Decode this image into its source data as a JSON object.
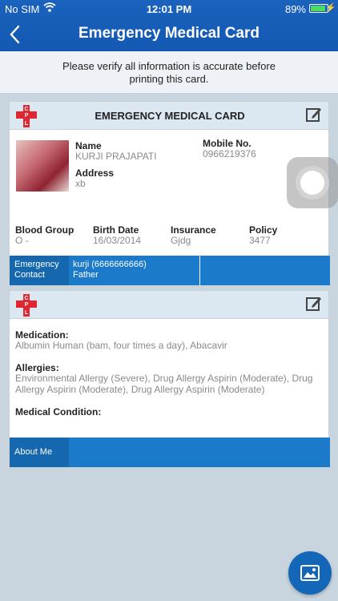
{
  "status_bar": {
    "carrier": "No SIM",
    "time": "12:01 PM",
    "battery_pct": "89%"
  },
  "header": {
    "title": "Emergency Medical Card"
  },
  "notice": {
    "text": "Please verify all information is accurate before printing this card."
  },
  "card": {
    "title": "EMERGENCY MEDICAL CARD",
    "logo_letters": [
      "C",
      "P",
      "L"
    ],
    "name_label": "Name",
    "name": "KURJI PRAJAPATI",
    "mobile_label": "Mobile No.",
    "mobile": "0966219376",
    "address_label": "Address",
    "address": "xb",
    "blood_group_label": "Blood Group",
    "blood_group": "O -",
    "birth_date_label": "Birth Date",
    "birth_date": "16/03/2014",
    "insurance_label": "Insurance",
    "insurance": "Gjdg",
    "policy_label": "Policy",
    "policy": "3477",
    "emergency_label": "Emergency Contact",
    "emergency_contact_name": "kurji (6666666666)",
    "emergency_contact_relation": "Father"
  },
  "medical": {
    "medication_label": "Medication:",
    "medication": "Albumin Human (bam, four times a day), Abacavir",
    "allergies_label": "Allergies:",
    "allergies": "Environmental Allergy (Severe), Drug Allergy Aspirin (Moderate), Drug Allergy Aspirin (Moderate), Drug Allergy Aspirin (Moderate)",
    "condition_label": "Medical Condition:",
    "condition": "",
    "about_label": "About Me"
  },
  "icons": {
    "back": "chevron-left-icon",
    "edit": "edit-icon",
    "fab": "image-icon"
  },
  "colors": {
    "header": "#1a62bd",
    "bar": "#1b7ac9",
    "logo_red": "#e02630"
  }
}
